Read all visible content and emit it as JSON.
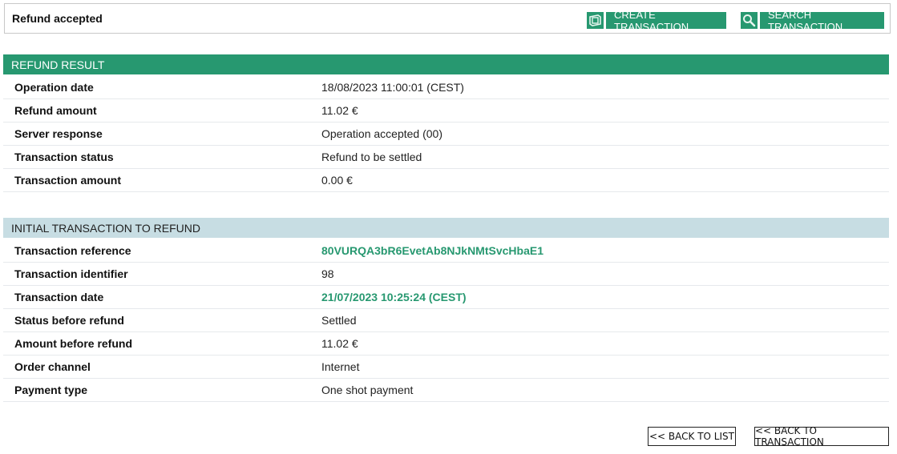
{
  "header": {
    "title": "Refund accepted",
    "buttons": {
      "create": {
        "label": "CREATE TRANSACTION",
        "icon": "money-icon"
      },
      "search": {
        "label": "SEARCH TRANSACTION",
        "icon": "search-icon"
      }
    }
  },
  "refund_result": {
    "title": "REFUND RESULT",
    "rows": [
      {
        "label": "Operation date",
        "value": "18/08/2023 11:00:01 (CEST)"
      },
      {
        "label": "Refund amount",
        "value": "11.02  €"
      },
      {
        "label": "Server response",
        "value": "Operation accepted (00)"
      },
      {
        "label": "Transaction status",
        "value": "Refund to be settled"
      },
      {
        "label": "Transaction amount",
        "value": "0.00  €"
      }
    ]
  },
  "initial_transaction": {
    "title": "INITIAL TRANSACTION TO REFUND",
    "rows": [
      {
        "label": "Transaction reference",
        "value": "80VURQA3bR6EvetAb8NJkNMtSvcHbaE1"
      },
      {
        "label": "Transaction identifier",
        "value": "98"
      },
      {
        "label": "Transaction date",
        "value": "21/07/2023 10:25:24 (CEST)"
      },
      {
        "label": "Status before refund",
        "value": "Settled"
      },
      {
        "label": "Amount before refund",
        "value": "11.02  €"
      },
      {
        "label": "Order channel",
        "value": "Internet"
      },
      {
        "label": "Payment type",
        "value": "One shot payment"
      }
    ]
  },
  "footer": {
    "back_to_list": "<< BACK TO LIST",
    "back_to_transaction": "<< BACK TO TRANSACTION"
  },
  "colors": {
    "accent": "#279870",
    "section_secondary": "#c7dde3"
  }
}
